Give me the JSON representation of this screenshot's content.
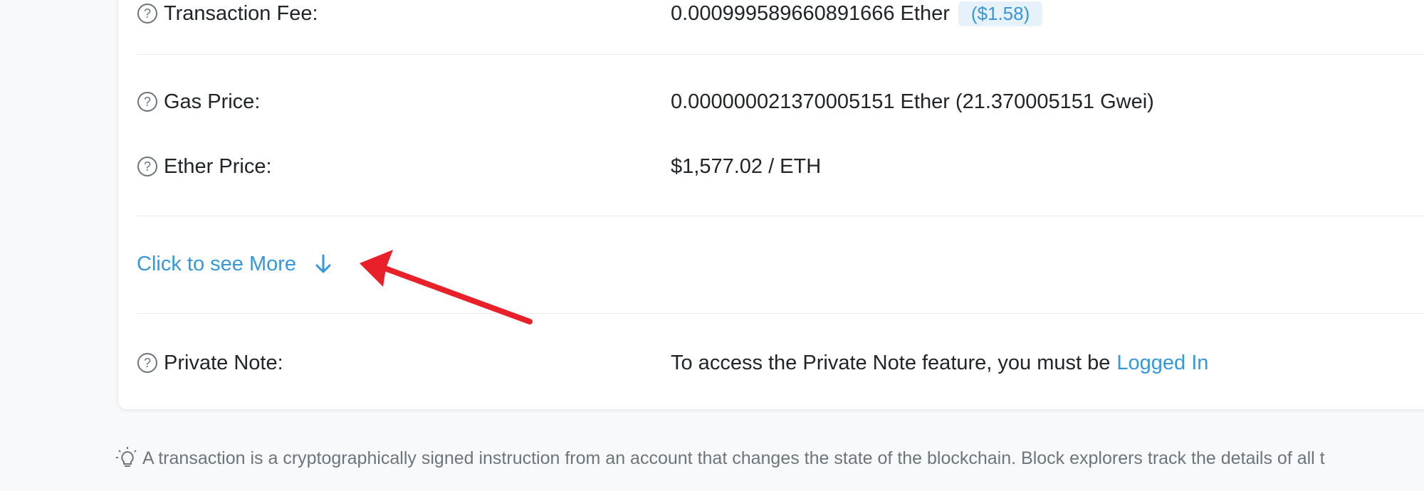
{
  "details": {
    "transaction_fee": {
      "label": "Transaction Fee:",
      "value": "0.000999589660891666 Ether",
      "usd_badge": "($1.58)"
    },
    "gas_price": {
      "label": "Gas Price:",
      "value": "0.000000021370005151 Ether (21.370005151 Gwei)"
    },
    "ether_price": {
      "label": "Ether Price:",
      "value": "$1,577.02 / ETH"
    },
    "more": {
      "label": "Click to see More",
      "icon": "arrow-down-icon"
    },
    "private_note": {
      "label": "Private Note:",
      "value_prefix": "To access the Private Note feature, you must be",
      "login_link": "Logged In"
    }
  },
  "footer": {
    "icon": "lightbulb-icon",
    "text": "A transaction is a cryptographically signed instruction from an account that changes the state of the blockchain. Block explorers track the details of all t"
  },
  "colors": {
    "link": "#3498db",
    "annotation_arrow": "#e8202a",
    "background": "#f8f9fa",
    "card": "#ffffff"
  }
}
